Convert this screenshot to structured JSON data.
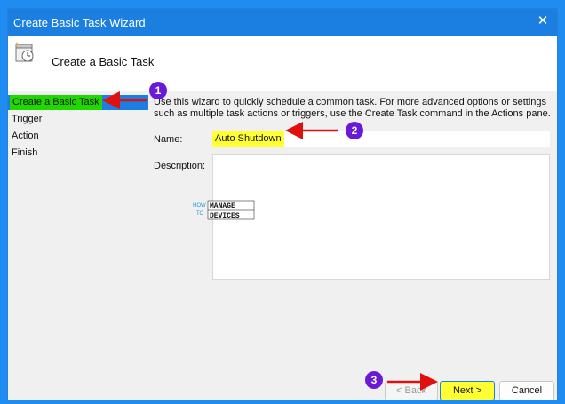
{
  "window": {
    "title": "Create Basic Task Wizard",
    "close_glyph": "✕"
  },
  "header": {
    "title": "Create a Basic Task",
    "icon": "task-scheduler-icon"
  },
  "sidebar": {
    "items": [
      {
        "label": "Create a Basic Task",
        "active": true
      },
      {
        "label": "Trigger",
        "active": false
      },
      {
        "label": "Action",
        "active": false
      },
      {
        "label": "Finish",
        "active": false
      }
    ]
  },
  "content": {
    "description": "Use this wizard to quickly schedule a common task.  For more advanced options or settings such as multiple task actions or triggers, use the Create Task command in the Actions pane.",
    "name_label": "Name:",
    "name_value": "Auto Shutdown",
    "description_label": "Description:",
    "description_value": ""
  },
  "watermark": {
    "line1a": "HOW",
    "line1b": "TO",
    "line2a": "MANAGE",
    "line2b": "DEVICES"
  },
  "buttons": {
    "back_label": "< Back",
    "next_label": "Next >",
    "cancel_label": "Cancel"
  },
  "annotations": {
    "badge1": "1",
    "badge2": "2",
    "badge3": "3"
  },
  "colors": {
    "accent": "#1a7fe0",
    "highlight_green": "#1ed800",
    "highlight_yellow": "#ffff33",
    "badge": "#6a1ad6",
    "arrow": "#e01010"
  }
}
